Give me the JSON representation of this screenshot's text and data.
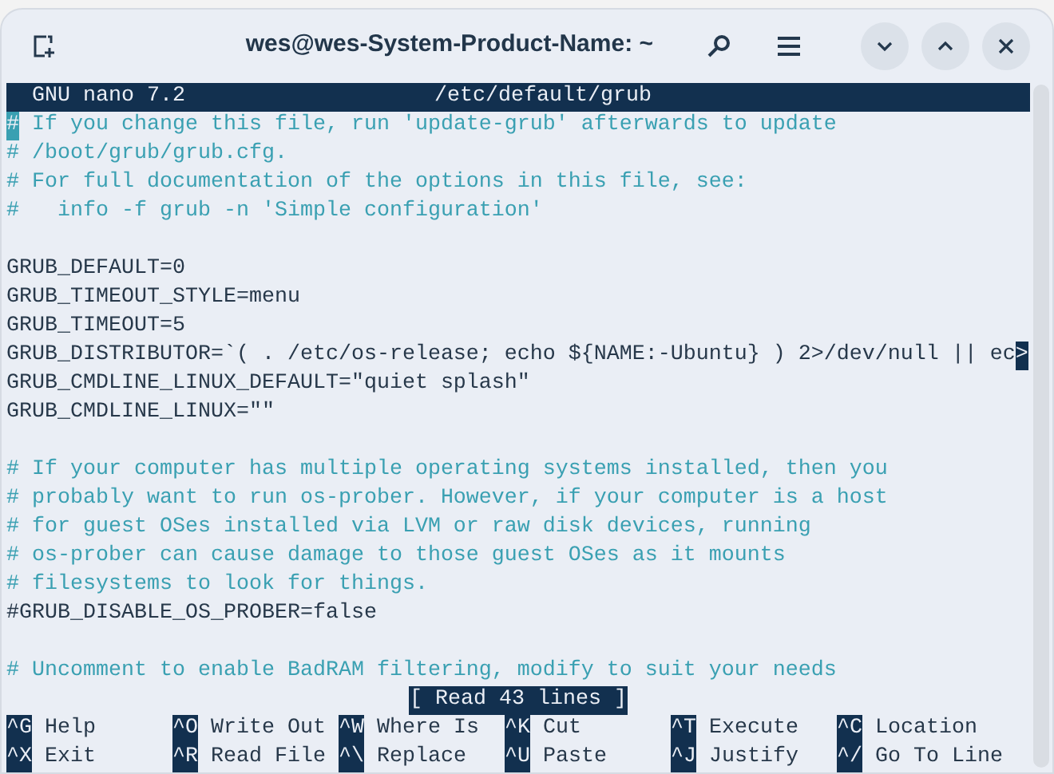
{
  "window": {
    "title": "wes@wes-System-Product-Name: ~"
  },
  "header": {
    "version": "GNU nano 7.2",
    "filename": "/etc/default/grub"
  },
  "lines": [
    {
      "kind": "comment",
      "text": "# If you change this file, run 'update-grub' afterwards to update",
      "cursor": true
    },
    {
      "kind": "comment",
      "text": "# /boot/grub/grub.cfg.",
      "cursor": false
    },
    {
      "kind": "comment",
      "text": "# For full documentation of the options in this file, see:",
      "cursor": false
    },
    {
      "kind": "comment",
      "text": "#   info -f grub -n 'Simple configuration'",
      "cursor": false
    },
    {
      "kind": "blank",
      "cursor": false
    },
    {
      "kind": "code",
      "text": "GRUB_DEFAULT=0",
      "cursor": false
    },
    {
      "kind": "code",
      "text": "GRUB_TIMEOUT_STYLE=menu",
      "cursor": false
    },
    {
      "kind": "code",
      "text": "GRUB_TIMEOUT=5",
      "cursor": false
    },
    {
      "kind": "code",
      "text": "GRUB_DISTRIBUTOR=`( . /etc/os-release; echo ${NAME:-Ubuntu} ) 2>/dev/null || ec",
      "overflow_marker": ">",
      "cursor": false
    },
    {
      "kind": "code",
      "text": "GRUB_CMDLINE_LINUX_DEFAULT=\"quiet splash\"",
      "cursor": false
    },
    {
      "kind": "code",
      "text": "GRUB_CMDLINE_LINUX=\"\"",
      "cursor": false
    },
    {
      "kind": "blank",
      "cursor": false
    },
    {
      "kind": "comment",
      "text": "# If your computer has multiple operating systems installed, then you",
      "cursor": false
    },
    {
      "kind": "comment",
      "text": "# probably want to run os-prober. However, if your computer is a host",
      "cursor": false
    },
    {
      "kind": "comment",
      "text": "# for guest OSes installed via LVM or raw disk devices, running",
      "cursor": false
    },
    {
      "kind": "comment",
      "text": "# os-prober can cause damage to those guest OSes as it mounts",
      "cursor": false
    },
    {
      "kind": "comment",
      "text": "# filesystems to look for things.",
      "cursor": false
    },
    {
      "kind": "code",
      "text": "#GRUB_DISABLE_OS_PROBER=false",
      "cursor": false
    },
    {
      "kind": "blank",
      "cursor": false
    },
    {
      "kind": "comment",
      "text": "# Uncomment to enable BadRAM filtering, modify to suit your needs",
      "cursor": false
    }
  ],
  "status": "[ Read 43 lines ]",
  "shortcuts": [
    [
      {
        "key": "^G",
        "label": "Help"
      },
      {
        "key": "^O",
        "label": "Write Out"
      },
      {
        "key": "^W",
        "label": "Where Is"
      },
      {
        "key": "^K",
        "label": "Cut"
      },
      {
        "key": "^T",
        "label": "Execute"
      },
      {
        "key": "^C",
        "label": "Location"
      }
    ],
    [
      {
        "key": "^X",
        "label": "Exit"
      },
      {
        "key": "^R",
        "label": "Read File"
      },
      {
        "key": "^\\",
        "label": "Replace"
      },
      {
        "key": "^U",
        "label": "Paste"
      },
      {
        "key": "^J",
        "label": "Justify"
      },
      {
        "key": "^/",
        "label": "Go To Line"
      }
    ]
  ]
}
